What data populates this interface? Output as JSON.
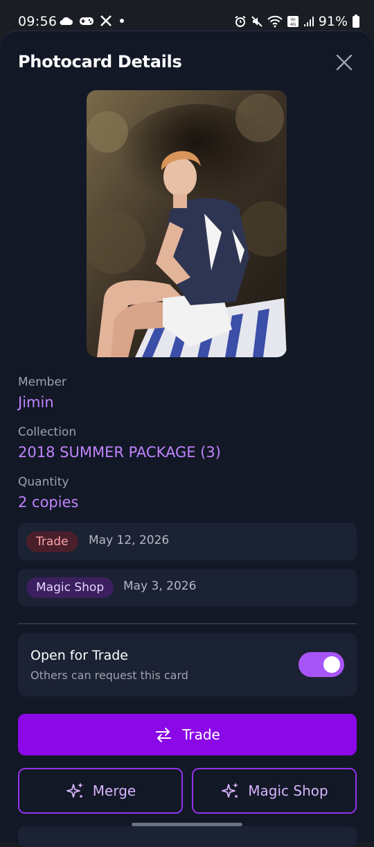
{
  "status_bar": {
    "time": "09:56",
    "battery": "91%",
    "left_icons": [
      "cloud-icon",
      "game-controller-icon",
      "x-logo-icon",
      "dot-icon"
    ],
    "right_icons": [
      "alarm-icon",
      "mute-icon",
      "wifi-icon",
      "volte-icon",
      "signal-icon",
      "battery-icon"
    ]
  },
  "sheet": {
    "title": "Photocard Details",
    "close_icon": "close-icon"
  },
  "details": {
    "member_label": "Member",
    "member_value": "Jimin",
    "collection_label": "Collection",
    "collection_value": "2018 SUMMER PACKAGE (3)",
    "quantity_label": "Quantity",
    "quantity_value": "2 copies"
  },
  "history": [
    {
      "badge": "Trade",
      "date": "May 12, 2026",
      "color": "#fca5a5"
    },
    {
      "badge": "Magic Shop",
      "date": "May 3, 2026",
      "color": "#e9d5ff"
    }
  ],
  "trade_toggle": {
    "title": "Open for Trade",
    "subtitle": "Others can request this card",
    "enabled": true
  },
  "actions": {
    "trade_label": "Trade",
    "merge_label": "Merge",
    "magic_shop_label": "Magic Shop"
  },
  "colors": {
    "accent": "#8b09e6",
    "accent_light": "#c084fc",
    "background": "#121826",
    "card": "#1b2233"
  }
}
